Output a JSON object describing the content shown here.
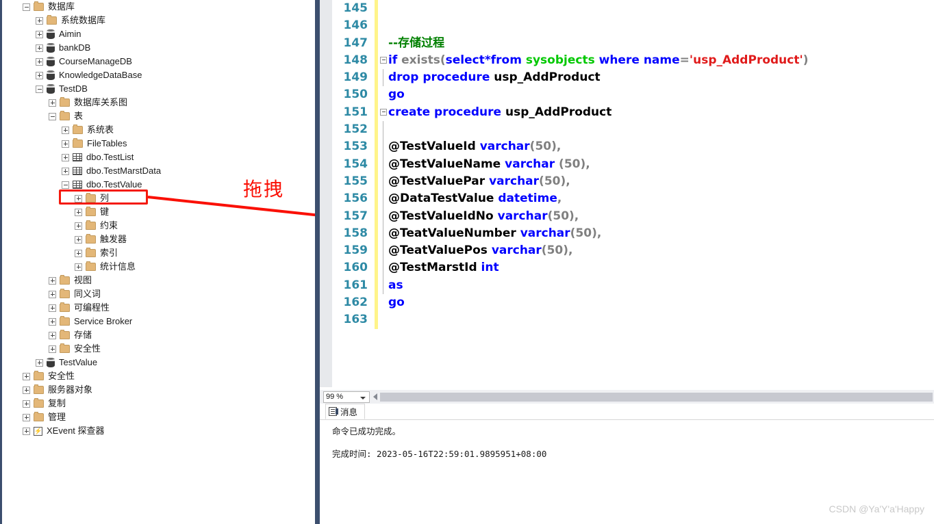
{
  "explorer": {
    "name": "object-explorer",
    "nodes": [
      {
        "label": "数据库",
        "indent": 0,
        "state": "minus",
        "icon": "folder-icon"
      },
      {
        "label": "系统数据库",
        "indent": 1,
        "state": "plus",
        "icon": "folder-icon"
      },
      {
        "label": "Aimin",
        "indent": 1,
        "state": "plus",
        "icon": "database-icon"
      },
      {
        "label": "bankDB",
        "indent": 1,
        "state": "plus",
        "icon": "database-icon"
      },
      {
        "label": "CourseManageDB",
        "indent": 1,
        "state": "plus",
        "icon": "database-icon"
      },
      {
        "label": "KnowledgeDataBase",
        "indent": 1,
        "state": "plus",
        "icon": "database-icon"
      },
      {
        "label": "TestDB",
        "indent": 1,
        "state": "minus",
        "icon": "database-icon"
      },
      {
        "label": "数据库关系图",
        "indent": 2,
        "state": "plus",
        "icon": "folder-icon"
      },
      {
        "label": "表",
        "indent": 2,
        "state": "minus",
        "icon": "folder-icon"
      },
      {
        "label": "系统表",
        "indent": 3,
        "state": "plus",
        "icon": "folder-icon"
      },
      {
        "label": "FileTables",
        "indent": 3,
        "state": "plus",
        "icon": "folder-icon"
      },
      {
        "label": "dbo.TestList",
        "indent": 3,
        "state": "plus",
        "icon": "table-icon"
      },
      {
        "label": "dbo.TestMarstData",
        "indent": 3,
        "state": "plus",
        "icon": "table-icon"
      },
      {
        "label": "dbo.TestValue",
        "indent": 3,
        "state": "minus",
        "icon": "table-icon"
      },
      {
        "label": "列",
        "indent": 4,
        "state": "plus",
        "icon": "folder-icon",
        "highlighted": true
      },
      {
        "label": "键",
        "indent": 4,
        "state": "plus",
        "icon": "folder-icon"
      },
      {
        "label": "约束",
        "indent": 4,
        "state": "plus",
        "icon": "folder-icon"
      },
      {
        "label": "触发器",
        "indent": 4,
        "state": "plus",
        "icon": "folder-icon"
      },
      {
        "label": "索引",
        "indent": 4,
        "state": "plus",
        "icon": "folder-icon"
      },
      {
        "label": "统计信息",
        "indent": 4,
        "state": "plus",
        "icon": "folder-icon"
      },
      {
        "label": "视图",
        "indent": 2,
        "state": "plus",
        "icon": "folder-icon"
      },
      {
        "label": "同义词",
        "indent": 2,
        "state": "plus",
        "icon": "folder-icon"
      },
      {
        "label": "可编程性",
        "indent": 2,
        "state": "plus",
        "icon": "folder-icon"
      },
      {
        "label": "Service Broker",
        "indent": 2,
        "state": "plus",
        "icon": "folder-icon"
      },
      {
        "label": "存储",
        "indent": 2,
        "state": "plus",
        "icon": "folder-icon"
      },
      {
        "label": "安全性",
        "indent": 2,
        "state": "plus",
        "icon": "folder-icon"
      },
      {
        "label": "TestValue",
        "indent": 1,
        "state": "plus",
        "icon": "database-icon"
      },
      {
        "label": "安全性",
        "indent": 0,
        "state": "plus",
        "icon": "folder-icon"
      },
      {
        "label": "服务器对象",
        "indent": 0,
        "state": "plus",
        "icon": "folder-icon"
      },
      {
        "label": "复制",
        "indent": 0,
        "state": "plus",
        "icon": "folder-icon"
      },
      {
        "label": "管理",
        "indent": 0,
        "state": "plus",
        "icon": "folder-icon"
      },
      {
        "label": "XEvent 探查器",
        "indent": 0,
        "state": "plus",
        "icon": "xevent-icon"
      }
    ]
  },
  "annotation": {
    "label": "拖拽",
    "color": "#fa1005",
    "arrow_from_node": "列",
    "arrow_to_line": 157
  },
  "editor": {
    "first_line_number": 145,
    "lines": [
      {
        "num": 145,
        "fold": "",
        "tokens": []
      },
      {
        "num": 146,
        "fold": "",
        "tokens": []
      },
      {
        "num": 147,
        "fold": "",
        "tokens": [
          {
            "t": "--存储过程",
            "c": "cmt"
          }
        ]
      },
      {
        "num": 148,
        "fold": "minus",
        "tokens": [
          {
            "t": "if",
            "c": "kw"
          },
          {
            "t": " ",
            "c": "plain"
          },
          {
            "t": "exists",
            "c": "gray"
          },
          {
            "t": "(",
            "c": "gray"
          },
          {
            "t": "select",
            "c": "kw"
          },
          {
            "t": "*",
            "c": "kw"
          },
          {
            "t": "from",
            "c": "kw"
          },
          {
            "t": " ",
            "c": "plain"
          },
          {
            "t": "sysobjects",
            "c": "obj"
          },
          {
            "t": " ",
            "c": "plain"
          },
          {
            "t": "where",
            "c": "kw"
          },
          {
            "t": " ",
            "c": "plain"
          },
          {
            "t": "name",
            "c": "kw"
          },
          {
            "t": "=",
            "c": "gray"
          },
          {
            "t": "'usp_AddProduct'",
            "c": "str"
          },
          {
            "t": ")",
            "c": "gray"
          }
        ]
      },
      {
        "num": 149,
        "fold": "line",
        "tokens": [
          {
            "t": "drop procedure",
            "c": "kw"
          },
          {
            "t": " ",
            "c": "plain"
          },
          {
            "t": "usp_AddProduct",
            "c": "plain"
          }
        ]
      },
      {
        "num": 150,
        "fold": "",
        "tokens": [
          {
            "t": "go",
            "c": "kw"
          }
        ]
      },
      {
        "num": 151,
        "fold": "minus",
        "tokens": [
          {
            "t": "create procedure",
            "c": "kw"
          },
          {
            "t": " ",
            "c": "plain"
          },
          {
            "t": "usp_AddProduct",
            "c": "plain"
          }
        ]
      },
      {
        "num": 152,
        "fold": "line",
        "tokens": []
      },
      {
        "num": 153,
        "fold": "line",
        "tokens": [
          {
            "t": "@TestValueId",
            "c": "plain"
          },
          {
            "t": " ",
            "c": "plain"
          },
          {
            "t": "varchar",
            "c": "kw"
          },
          {
            "t": "(50),",
            "c": "gray"
          }
        ]
      },
      {
        "num": 154,
        "fold": "line",
        "tokens": [
          {
            "t": "@TestValueName",
            "c": "plain"
          },
          {
            "t": " ",
            "c": "plain"
          },
          {
            "t": "varchar",
            "c": "kw"
          },
          {
            "t": " (50),",
            "c": "gray"
          }
        ]
      },
      {
        "num": 155,
        "fold": "line",
        "tokens": [
          {
            "t": "@TestValuePar",
            "c": "plain"
          },
          {
            "t": " ",
            "c": "plain"
          },
          {
            "t": "varchar",
            "c": "kw"
          },
          {
            "t": "(50),",
            "c": "gray"
          }
        ]
      },
      {
        "num": 156,
        "fold": "line",
        "tokens": [
          {
            "t": "@DataTestValue",
            "c": "plain"
          },
          {
            "t": " ",
            "c": "plain"
          },
          {
            "t": "datetime",
            "c": "kw"
          },
          {
            "t": ",",
            "c": "gray"
          }
        ]
      },
      {
        "num": 157,
        "fold": "line",
        "tokens": [
          {
            "t": "@TestValueIdNo",
            "c": "plain"
          },
          {
            "t": " ",
            "c": "plain"
          },
          {
            "t": "varchar",
            "c": "kw"
          },
          {
            "t": "(50),",
            "c": "gray"
          }
        ]
      },
      {
        "num": 158,
        "fold": "line",
        "tokens": [
          {
            "t": "@TeatValueNumber",
            "c": "plain"
          },
          {
            "t": " ",
            "c": "plain"
          },
          {
            "t": "varchar",
            "c": "kw"
          },
          {
            "t": "(50),",
            "c": "gray"
          }
        ]
      },
      {
        "num": 159,
        "fold": "line",
        "tokens": [
          {
            "t": "@TeatValuePos",
            "c": "plain"
          },
          {
            "t": " ",
            "c": "plain"
          },
          {
            "t": "varchar",
            "c": "kw"
          },
          {
            "t": "(50),",
            "c": "gray"
          }
        ]
      },
      {
        "num": 160,
        "fold": "line",
        "tokens": [
          {
            "t": "@TestMarstId",
            "c": "plain"
          },
          {
            "t": " ",
            "c": "plain"
          },
          {
            "t": "int",
            "c": "kw"
          }
        ]
      },
      {
        "num": 161,
        "fold": "line",
        "tokens": [
          {
            "t": "as",
            "c": "kw"
          }
        ]
      },
      {
        "num": 162,
        "fold": "",
        "tokens": [
          {
            "t": "go",
            "c": "kw"
          }
        ]
      },
      {
        "num": 163,
        "fold": "",
        "tokens": []
      }
    ]
  },
  "editor_bottom": {
    "zoom_value": "99 %",
    "scrollbar": "horizontal-scrollbar"
  },
  "messages": {
    "tab_label": "消息",
    "line1": "命令已成功完成。",
    "line2": "完成时间: 2023-05-16T22:59:01.9895951+08:00"
  },
  "watermark": "CSDN @Ya'Y'a'Happy"
}
